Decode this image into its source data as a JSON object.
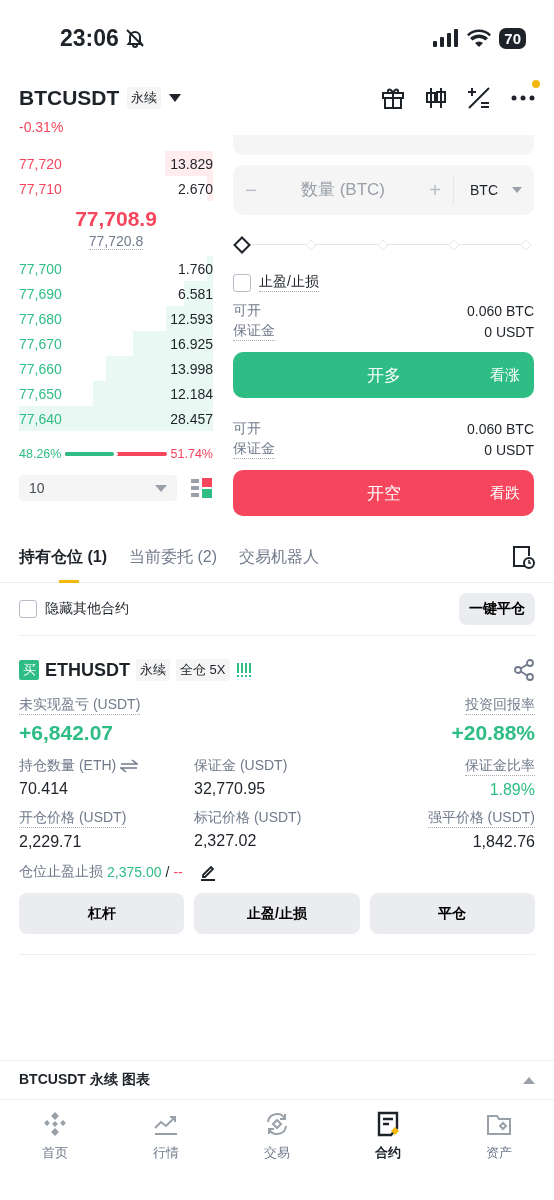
{
  "status_bar": {
    "time": "23:06",
    "battery": "70"
  },
  "header": {
    "symbol": "BTCUSDT",
    "tag": "永续",
    "change": "-0.31%"
  },
  "order_book": {
    "asks": [
      {
        "price": "77,720",
        "amount": "13.829"
      },
      {
        "price": "77,710",
        "amount": "2.670"
      }
    ],
    "last_price": "77,708.9",
    "mark_price": "77,720.8",
    "bids": [
      {
        "price": "77,700",
        "amount": "1.760"
      },
      {
        "price": "77,690",
        "amount": "6.581"
      },
      {
        "price": "77,680",
        "amount": "12.593"
      },
      {
        "price": "77,670",
        "amount": "16.925"
      },
      {
        "price": "77,660",
        "amount": "13.998"
      },
      {
        "price": "77,650",
        "amount": "12.184"
      },
      {
        "price": "77,640",
        "amount": "28.457"
      }
    ],
    "buy_ratio": "48.26%",
    "sell_ratio": "51.74%",
    "ratio_bar": {
      "level": 0.4826
    },
    "depth_select": "10"
  },
  "order_form": {
    "quantity": {
      "minus": "−",
      "placeholder": "数量 (BTC)",
      "plus": "+",
      "unit": "BTC"
    },
    "slider": {
      "level": 0
    },
    "tp_sl": {
      "label": "止盈/止损",
      "checked": false
    },
    "sides": [
      {
        "kind": "long",
        "available_label": "可开",
        "available": "0.060 BTC",
        "margin_label": "保证金",
        "margin": "0 USDT",
        "button": "开多",
        "hint": "看涨"
      },
      {
        "kind": "short",
        "available_label": "可开",
        "available": "0.060 BTC",
        "margin_label": "保证金",
        "margin": "0 USDT",
        "button": "开空",
        "hint": "看跌"
      }
    ]
  },
  "tabs": [
    {
      "label": "持有仓位 (1)",
      "selected": true
    },
    {
      "label": "当前委托 (2)",
      "selected": false
    },
    {
      "label": "交易机器人",
      "selected": false
    }
  ],
  "positions_toolbar": {
    "hide_others": {
      "label": "隐藏其他合约",
      "checked": false
    },
    "close_all": "一键平仓"
  },
  "position": {
    "side": "买",
    "symbol": "ETHUSDT",
    "tags": [
      "永续",
      "全仓 5X"
    ],
    "pnl": {
      "label": "未实现盈亏 (USDT)",
      "value": "+6,842.07"
    },
    "roe": {
      "label": "投资回报率",
      "value": "+20.88%"
    },
    "details": [
      {
        "label": "持仓数量 (ETH)",
        "value": "70.414",
        "positive": false
      },
      {
        "label": "保证金 (USDT)",
        "value": "32,770.95",
        "positive": false
      },
      {
        "label": "保证金比率",
        "value": "1.89%",
        "positive": true
      },
      {
        "label": "开仓价格 (USDT)",
        "value": "2,229.71",
        "positive": false
      },
      {
        "label": "标记价格 (USDT)",
        "value": "2,327.02",
        "positive": false
      },
      {
        "label": "强平价格 (USDT)",
        "value": "1,842.76",
        "positive": false
      }
    ],
    "tp_sl": {
      "label": "仓位止盈止损",
      "take_profit": "2,375.00",
      "separator": "/",
      "stop_loss": "--"
    },
    "actions": [
      "杠杆",
      "止盈/止损",
      "平仓"
    ]
  },
  "chart_bar": {
    "title": "BTCUSDT 永续 图表"
  },
  "nav": [
    {
      "label": "首页",
      "selected": false
    },
    {
      "label": "行情",
      "selected": false
    },
    {
      "label": "交易",
      "selected": false
    },
    {
      "label": "合约",
      "selected": true
    },
    {
      "label": "资产",
      "selected": false
    }
  ]
}
